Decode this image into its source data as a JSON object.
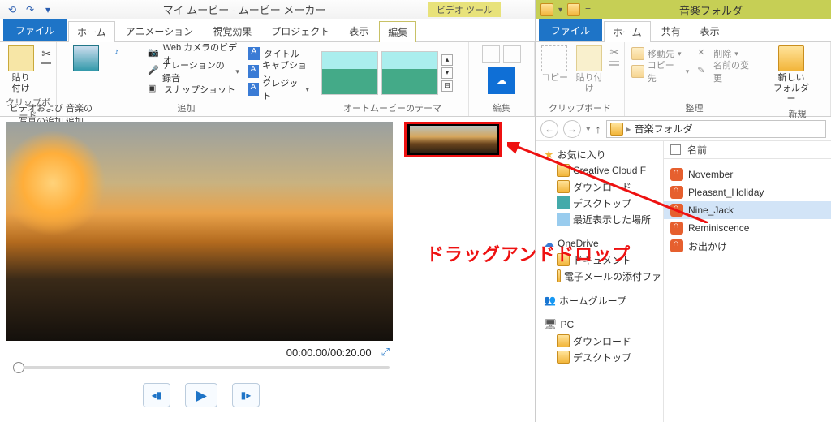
{
  "mm": {
    "qat": [
      "⟲",
      "↷",
      "▾"
    ],
    "title": "マイ ムービー - ムービー メーカー",
    "context_tab": "ビデオ ツール",
    "tabs": {
      "file": "ファイル",
      "home": "ホーム",
      "anim": "アニメーション",
      "vfx": "視覚効果",
      "project": "プロジェクト",
      "view": "表示",
      "edit": "編集"
    },
    "ribbon": {
      "clipboard": {
        "paste": "貼り\n付け",
        "label": "クリップボード"
      },
      "add": {
        "big": "ビデオおよび 音楽の\n写真の追加 追加",
        "web": "Web カメラのビデオ",
        "narration": "ナレーションの録音",
        "snapshot": "スナップショット",
        "title": "タイトル",
        "caption": "キャプション",
        "credit": "クレジット",
        "label": "追加"
      },
      "theme": {
        "label": "オートムービーのテーマ"
      },
      "edit": {
        "label": "編集"
      }
    },
    "timecode": "00:00.00/00:20.00",
    "controls": {
      "prev": "◂▮",
      "play": "▶",
      "next": "▮▸"
    },
    "fullscreen": "⤢"
  },
  "ex": {
    "title": "音楽フォルダ",
    "tabs": {
      "file": "ファイル",
      "home": "ホーム",
      "share": "共有",
      "view": "表示"
    },
    "ribbon": {
      "clipboard": {
        "copy": "コピー",
        "paste": "貼り付け",
        "label": "クリップボード"
      },
      "organize": {
        "move": "移動先",
        "copyto": "コピー先",
        "delete": "削除",
        "rename": "名前の変更",
        "label": "整理"
      },
      "new": {
        "newfolder": "新しい\nフォルダー",
        "label": "新規"
      }
    },
    "address": "音楽フォルダ",
    "tree": {
      "fav": "お気に入り",
      "fav_items": [
        "Creative Cloud F",
        "ダウンロード",
        "デスクトップ",
        "最近表示した場所"
      ],
      "onedrive": "OneDrive",
      "od_items": [
        "ドキュメント",
        "電子メールの添付ファ"
      ],
      "homegroup": "ホームグループ",
      "pc": "PC",
      "pc_items": [
        "ダウンロード",
        "デスクトップ"
      ]
    },
    "list": {
      "header": "名前",
      "files": [
        "November",
        "Pleasant_Holiday",
        "Nine_Jack",
        "Reminiscence",
        "お出かけ"
      ]
    }
  },
  "overlay": {
    "label": "ドラッグアンドドロップ"
  }
}
